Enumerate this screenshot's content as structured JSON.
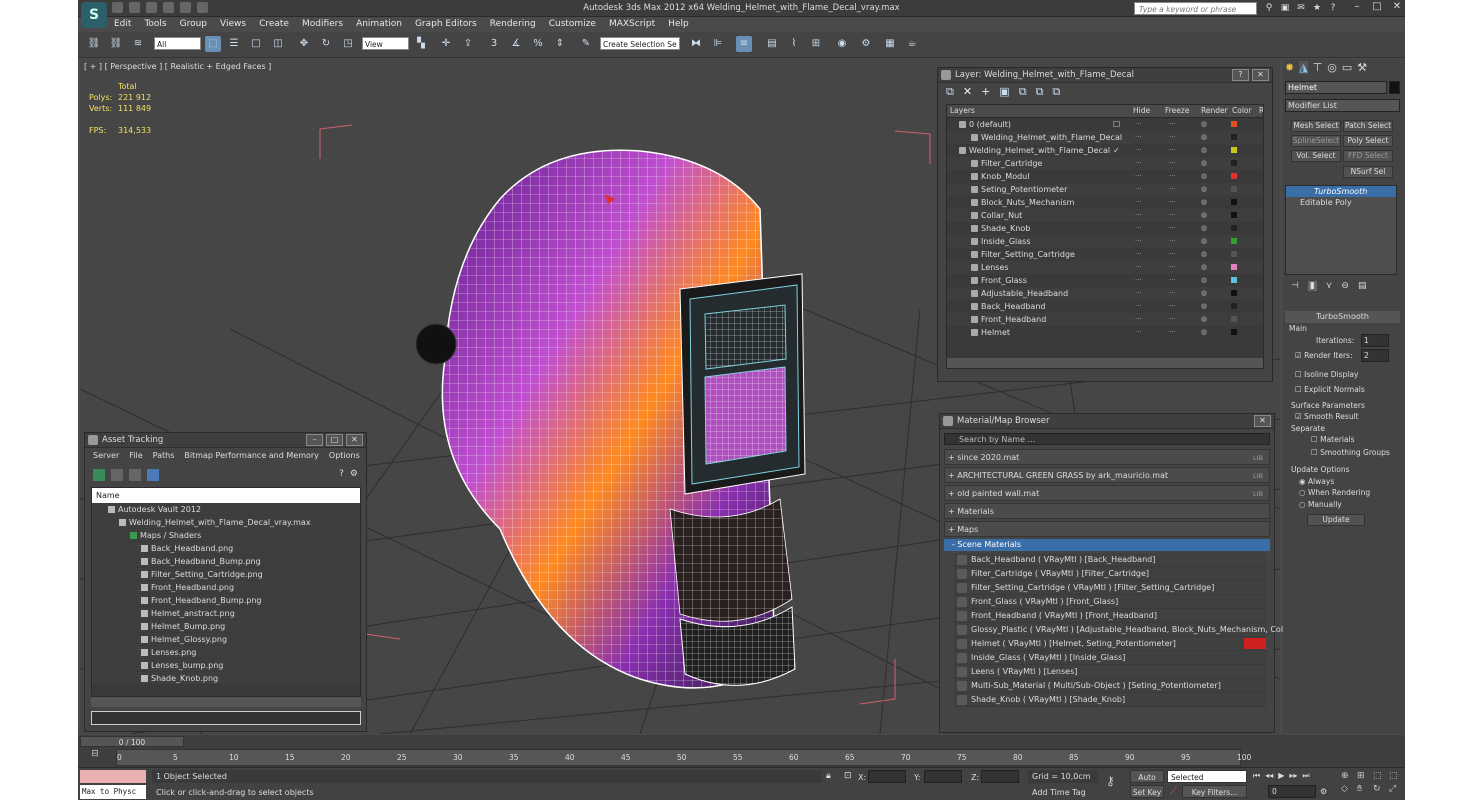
{
  "window": {
    "title": "Autodesk 3ds Max  2012 x64     Welding_Helmet_with_Flame_Decal_vray.max",
    "search_placeholder": "Type a keyword or phrase"
  },
  "menu": [
    "Edit",
    "Tools",
    "Group",
    "Views",
    "Create",
    "Modifiers",
    "Animation",
    "Graph Editors",
    "Rendering",
    "Customize",
    "MAXScript",
    "Help"
  ],
  "toolbar": {
    "filter": "All",
    "refcoord": "View",
    "selset": "Create Selection Se"
  },
  "viewport": {
    "label": "[ + ] [ Perspective ] [ Realistic + Edged Faces ]",
    "stats_header": "Total",
    "polys_label": "Polys:",
    "polys": "221 912",
    "verts_label": "Verts:",
    "verts": "111 849",
    "fps_label": "FPS:",
    "fps": "314,533"
  },
  "layer": {
    "title": "Layer: Welding_Helmet_with_Flame_Decal",
    "headers": [
      "Layers",
      "Hide",
      "Freeze",
      "Render",
      "Color",
      "Radi"
    ],
    "rows": [
      {
        "name": "0 (default)",
        "indent": 0,
        "color": "#e05020"
      },
      {
        "name": "Welding_Helmet_with_Flame_Decal",
        "indent": 1,
        "color": "#222222"
      },
      {
        "name": "Welding_Helmet_with_Flame_Decal",
        "indent": 0,
        "color": "#c8c820"
      },
      {
        "name": "Filter_Cartridge",
        "indent": 1,
        "color": "#222222"
      },
      {
        "name": "Knob_Modul",
        "indent": 1,
        "color": "#e03030"
      },
      {
        "name": "Seting_Potentiometer",
        "indent": 1,
        "color": "#555555"
      },
      {
        "name": "Block_Nuts_Mechanism",
        "indent": 1,
        "color": "#111111"
      },
      {
        "name": "Collar_Nut",
        "indent": 1,
        "color": "#111111"
      },
      {
        "name": "Shade_Knob",
        "indent": 1,
        "color": "#222222"
      },
      {
        "name": "Inside_Glass",
        "indent": 1,
        "color": "#30a030"
      },
      {
        "name": "Filter_Setting_Cartridge",
        "indent": 1,
        "color": "#555555"
      },
      {
        "name": "Lenses",
        "indent": 1,
        "color": "#e080c0"
      },
      {
        "name": "Front_Glass",
        "indent": 1,
        "color": "#60c0e0"
      },
      {
        "name": "Adjustable_Headband",
        "indent": 1,
        "color": "#111111"
      },
      {
        "name": "Back_Headband",
        "indent": 1,
        "color": "#222222"
      },
      {
        "name": "Front_Headband",
        "indent": 1,
        "color": "#555555"
      },
      {
        "name": "Helmet",
        "indent": 1,
        "color": "#111111"
      }
    ]
  },
  "asset": {
    "title": "Asset Tracking",
    "menu": [
      "Server",
      "File",
      "Paths",
      "Bitmap Performance and Memory",
      "Options"
    ],
    "column": "Name",
    "rows": [
      {
        "name": "Autodesk Vault 2012",
        "indent": 0
      },
      {
        "name": "Welding_Helmet_with_Flame_Decal_vray.max",
        "indent": 1
      },
      {
        "name": "Maps / Shaders",
        "indent": 2
      },
      {
        "name": "Back_Headband.png",
        "indent": 3
      },
      {
        "name": "Back_Headband_Bump.png",
        "indent": 3
      },
      {
        "name": "Filter_Setting_Cartridge.png",
        "indent": 3
      },
      {
        "name": "Front_Headband.png",
        "indent": 3
      },
      {
        "name": "Front_Headband_Bump.png",
        "indent": 3
      },
      {
        "name": "Helmet_anstract.png",
        "indent": 3
      },
      {
        "name": "Helmet_Bump.png",
        "indent": 3
      },
      {
        "name": "Helmet_Glossy.png",
        "indent": 3
      },
      {
        "name": "Lenses.png",
        "indent": 3
      },
      {
        "name": "Lenses_bump.png",
        "indent": 3
      },
      {
        "name": "Shade_Knob.png",
        "indent": 3
      }
    ]
  },
  "matbrowser": {
    "title": "Material/Map Browser",
    "search": "Search by Name ...",
    "libs": [
      {
        "name": "+ since 2020.mat",
        "tag": "LIB"
      },
      {
        "name": "+ ARCHITECTURAL GREEN GRASS by ark_mauricio.mat",
        "tag": "LIB"
      },
      {
        "name": "+ old painted wall.mat",
        "tag": "LIB"
      },
      {
        "name": "+ Materials",
        "tag": ""
      },
      {
        "name": "+ Maps",
        "tag": ""
      }
    ],
    "scene_header": "- Scene Materials",
    "materials": [
      "Back_Headband  ( VRayMtl ) [Back_Headband]",
      "Filter_Cartridge  ( VRayMtl ) [Filter_Cartridge]",
      "Filter_Setting_Cartridge  ( VRayMtl ) [Filter_Setting_Cartridge]",
      "Front_Glass  ( VRayMtl ) [Front_Glass]",
      "Front_Headband  ( VRayMtl ) [Front_Headband]",
      "Glossy_Plastic ( VRayMtl ) [Adjustable_Headband, Block_Nuts_Mechanism, Coll...",
      "Helmet  ( VRayMtl ) [Helmet, Seting_Potentiometer]",
      "Inside_Glass  ( VRayMtl ) [Inside_Glass]",
      "Leens  ( VRayMtl ) [Lenses]",
      "Multi-Sub_Material  ( Multi/Sub-Object ) [Seting_Potentiometer]",
      "Shade_Knob  ( VRayMtl ) [Shade_Knob]"
    ]
  },
  "command": {
    "object_name": "Helmet",
    "modifier_list": "Modifier List",
    "buttons": [
      "Mesh Select",
      "Patch Select",
      "SplineSelect",
      "Poly Select",
      "Vol. Select",
      "FFD Select",
      "NSurf Sel"
    ],
    "stack": [
      "TurboSmooth",
      "Editable Poly"
    ],
    "rollout": "TurboSmooth",
    "main": "Main",
    "iterations_label": "Iterations:",
    "iterations": "1",
    "render_iters_label": "Render Iters:",
    "render_iters": "2",
    "isoline": "Isoline Display",
    "explicit": "Explicit Normals",
    "surface": "Surface Parameters",
    "smooth_result": "Smooth Result",
    "separate": "Separate",
    "materials": "Materials",
    "smoothing": "Smoothing Groups",
    "update_options": "Update Options",
    "always": "Always",
    "when_rendering": "When Rendering",
    "manually": "Manually",
    "update": "Update"
  },
  "timeline": {
    "frame": "0 / 100",
    "ticks": [
      "0",
      "5",
      "10",
      "15",
      "20",
      "25",
      "30",
      "35",
      "40",
      "45",
      "50",
      "55",
      "60",
      "65",
      "70",
      "75",
      "80",
      "85",
      "90",
      "95",
      "100"
    ]
  },
  "status": {
    "maxscript": "Max to Physc",
    "selected": "1 Object Selected",
    "prompt": "Click or click-and-drag to select objects",
    "x": "X:",
    "y": "Y:",
    "z": "Z:",
    "grid": "Grid = 10,0cm",
    "add_time_tag": "Add Time Tag",
    "autokey": "Auto Key",
    "setkey": "Set Key",
    "selected_dd": "Selected",
    "key_filters": "Key Filters...",
    "frame_field": "0"
  }
}
